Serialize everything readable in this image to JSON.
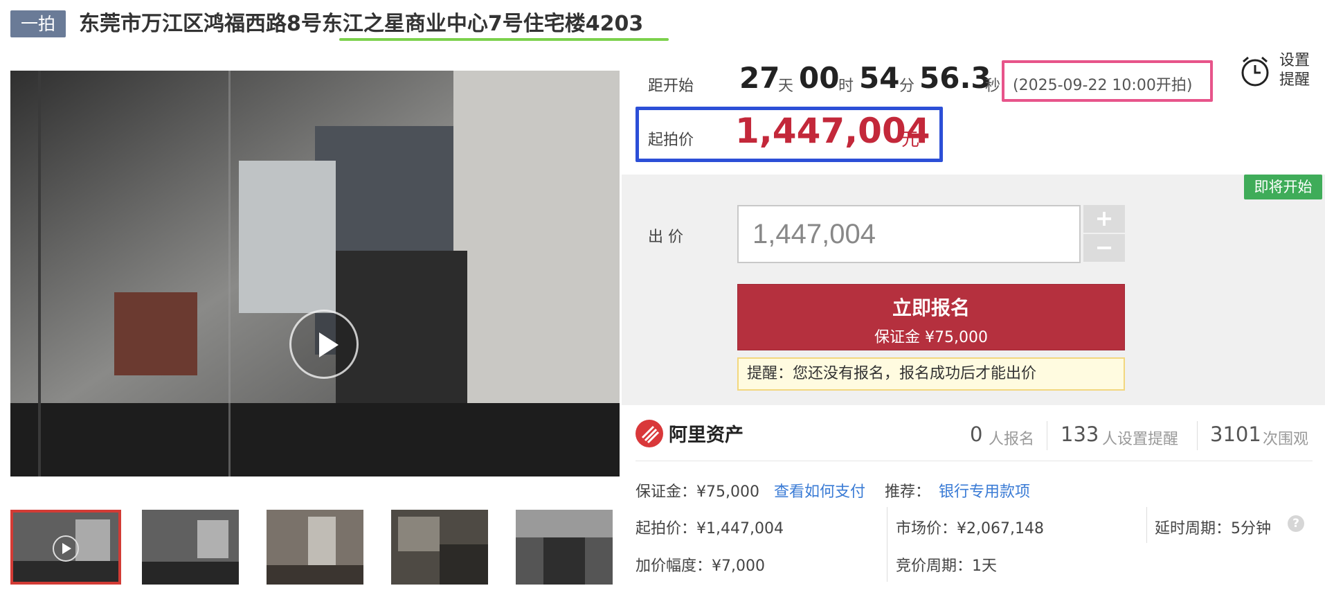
{
  "header": {
    "badge": "一拍",
    "title": "东莞市万江区鸿福西路8号东江之星商业中心7号住宅楼4203"
  },
  "countdown": {
    "label": "距开始",
    "days": "27",
    "days_unit": "天",
    "hours": "00",
    "hours_unit": "时",
    "minutes": "54",
    "minutes_unit": "分",
    "seconds": "56.3",
    "seconds_unit": "秒",
    "start_time": "(2025-09-22 10:00开拍)"
  },
  "reminder": {
    "line1": "设置",
    "line2": "提醒",
    "icon": "alarm-clock-icon"
  },
  "start_price": {
    "label": "起拍价",
    "value": "1,447,004",
    "unit": "元"
  },
  "status_tag": "即将开始",
  "bid": {
    "label": "出 价",
    "input_value": "1,447,004",
    "plus": "+",
    "minus": "−",
    "signup_label": "立即报名",
    "deposit_label": "保证金 ¥75,000",
    "notice": "提醒：您还没有报名，报名成功后才能出价"
  },
  "stats": {
    "brand": "阿里资产",
    "signups_num": "0",
    "signups_label": "人报名",
    "reminders_num": "133",
    "reminders_label": "人设置提醒",
    "views_num": "3101",
    "views_label": "次围观"
  },
  "info": {
    "deposit": "保证金：¥75,000",
    "how_to_pay": "查看如何支付",
    "recommend_label": "推荐：",
    "recommend_link": "银行专用款项",
    "start_price": "起拍价：¥1,447,004",
    "market_price": "市场价：¥2,067,148",
    "delay_period": "延时周期：5分钟",
    "increment": "加价幅度：¥7,000",
    "bid_period": "竞价周期：1天",
    "help_icon": "?"
  },
  "colors": {
    "accent_red": "#b5303e",
    "price_red": "#c3283a",
    "status_green": "#3fac59"
  }
}
